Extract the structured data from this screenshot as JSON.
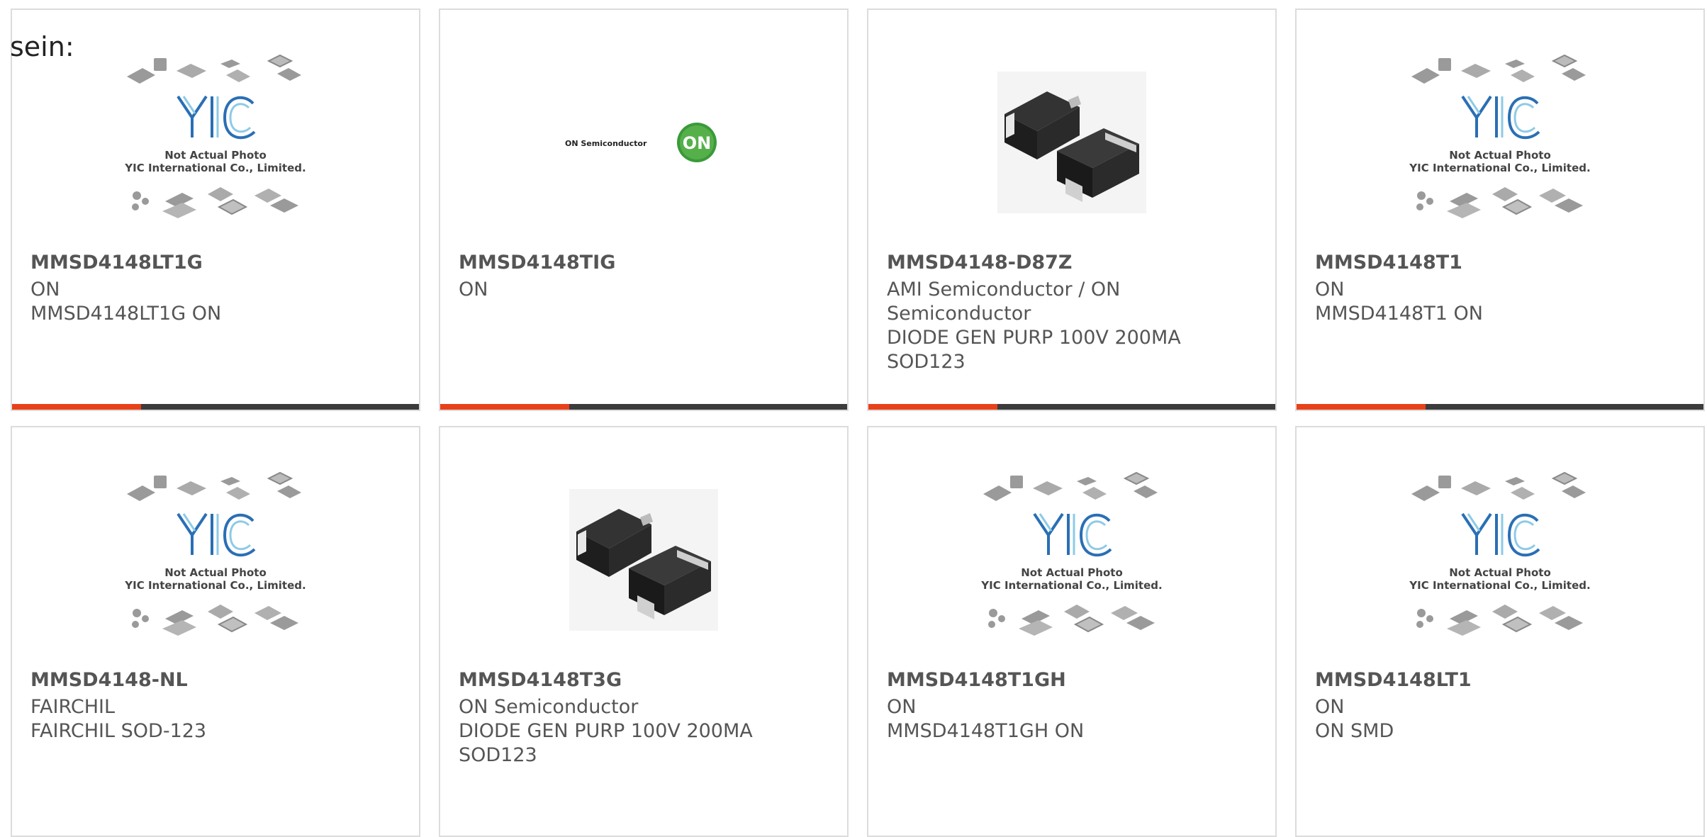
{
  "intro": "sein:",
  "placeholder": {
    "line1": "Not Actual Photo",
    "line2": "YIC International Co., Limited."
  },
  "on_logo": {
    "text": "ON Semiconductor",
    "badge": "ON"
  },
  "colors": {
    "accent": "#e8411a",
    "bar": "#3c3c3c",
    "border": "#dcdcdc",
    "ring": "#1f7a8c"
  },
  "products": [
    {
      "part": "MMSD4148LT1G",
      "lines": [
        "ON",
        "MMSD4148LT1G ON"
      ],
      "image": "placeholder-icon"
    },
    {
      "part": "MMSD4148TIG",
      "lines": [
        "ON"
      ],
      "image": "on-semiconductor-logo"
    },
    {
      "part": "MMSD4148-D87Z",
      "lines": [
        "AMI Semiconductor / ON",
        "Semiconductor",
        "DIODE GEN PURP 100V 200MA",
        "SOD123"
      ],
      "image": "diode-photo"
    },
    {
      "part": "MMSD4148T1",
      "lines": [
        "ON",
        "MMSD4148T1 ON"
      ],
      "image": "placeholder-icon"
    },
    {
      "part": "MMSD4148-NL",
      "lines": [
        "FAIRCHIL",
        "FAIRCHIL SOD-123"
      ],
      "image": "placeholder-icon"
    },
    {
      "part": "MMSD4148T3G",
      "lines": [
        "ON Semiconductor",
        "DIODE GEN PURP 100V 200MA",
        "SOD123"
      ],
      "image": "diode-photo"
    },
    {
      "part": "MMSD4148T1GH",
      "lines": [
        "ON",
        "MMSD4148T1GH ON"
      ],
      "image": "placeholder-icon"
    },
    {
      "part": "MMSD4148LT1",
      "lines": [
        "ON",
        "ON SMD"
      ],
      "image": "placeholder-icon"
    }
  ]
}
